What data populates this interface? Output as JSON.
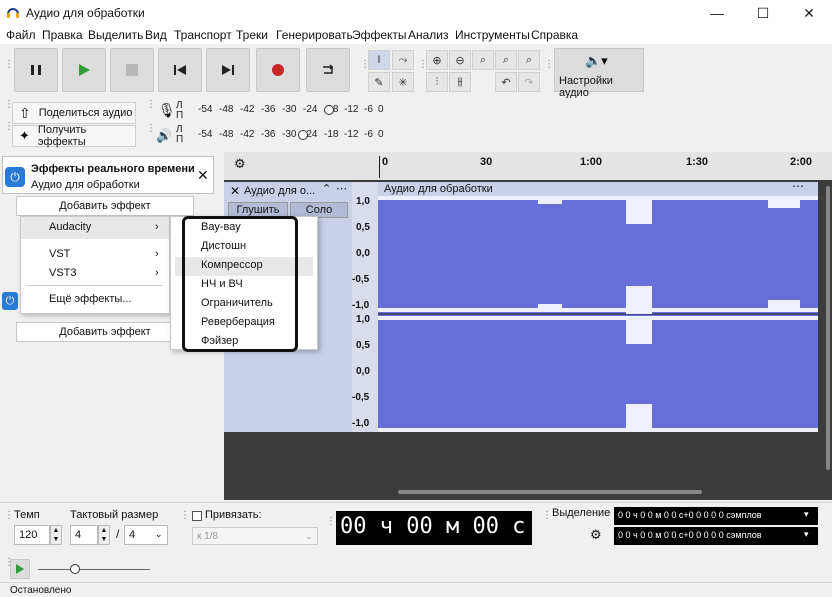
{
  "window": {
    "title": "Аудио для обработки",
    "minimize": "—",
    "maximize": "☐",
    "close": "✕"
  },
  "menubar": [
    "Файл",
    "Правка",
    "Выделить",
    "Вид",
    "Транспорт",
    "Треки",
    "Генерировать",
    "Эффекты",
    "Анализ",
    "Инструменты",
    "Справка"
  ],
  "toolbar": {
    "audio_settings": "Настройки аудио"
  },
  "row2": {
    "share_audio": "Поделиться аудио",
    "get_effects": "Получить эффекты",
    "meter_ticks": [
      "-54",
      "-48",
      "-42",
      "-36",
      "-30",
      "-24",
      "-18",
      "-12",
      "-6",
      "0"
    ],
    "meter_ticks2": [
      "-54",
      "-48",
      "-42",
      "-36",
      "-30",
      "-24",
      "-18",
      "-12",
      "-6",
      "0"
    ],
    "channel_l": "Л",
    "channel_r": "П"
  },
  "effects_panel": {
    "title": "Эффекты реального времени",
    "subtitle": "Аудио для обработки",
    "add_effect": "Добавить эффект",
    "add_effect2": "Добавить эффект"
  },
  "popup": {
    "categories": [
      "Audacity",
      "VST",
      "VST3",
      "Ещё эффекты..."
    ],
    "items": [
      "Вау-вау",
      "Дистошн",
      "Компрессор",
      "НЧ и ВЧ",
      "Ограничитель",
      "Реверберация",
      "Фэйзер"
    ]
  },
  "ruler": {
    "ticks": [
      "0",
      "30",
      "1:00",
      "1:30",
      "2:00"
    ]
  },
  "track": {
    "name": "Аудио для о...",
    "wave_title": "Аудио для обработки",
    "mute": "Глушить",
    "solo": "Соло",
    "scale_top": [
      "1,0",
      "0,5",
      "0,0",
      "-0,5",
      "-1,0"
    ],
    "scale_bottom": [
      "1,0",
      "0,5",
      "0,0",
      "-0,5",
      "-1,0"
    ],
    "wave_color": "#6670d8"
  },
  "bottom": {
    "tempo_label": "Темп",
    "tempo_value": "120",
    "timesig_label": "Тактовый размер",
    "timesig_num": "4",
    "timesig_sep": "/",
    "timesig_den": "4",
    "snap_label": "Привязать:",
    "snap_value": "к 1/8",
    "time_display": "00 ч 00 м 00 с",
    "selection_label": "Выделение",
    "sel_start": "0 0 ч 0 0 м 0 0 с+0 0 0 0 0 сэмплов",
    "sel_end": "0 0 ч 0 0 м 0 0 с+0 0 0 0 0 сэмплов"
  },
  "status": {
    "text": "Остановлено"
  }
}
